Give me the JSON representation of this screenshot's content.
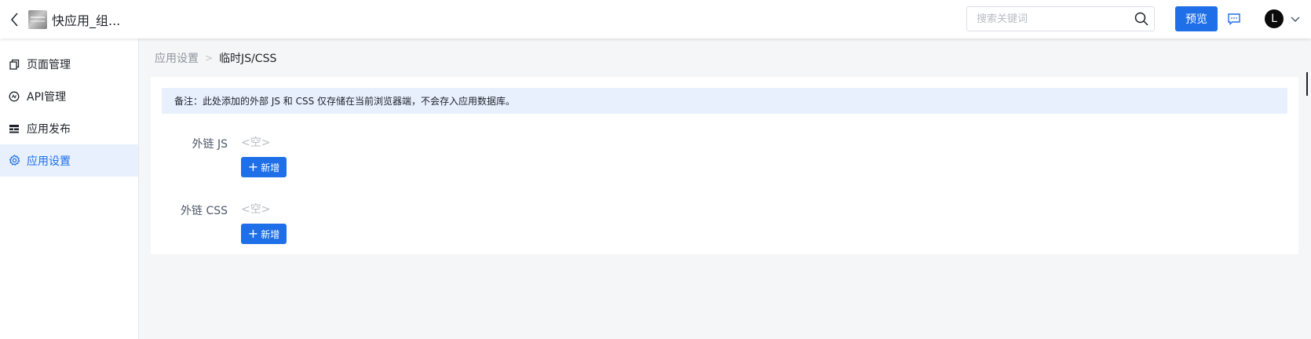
{
  "header": {
    "back_icon": "chevron-left-icon",
    "app_title": "快应用_组...",
    "search_placeholder": "搜索关键词",
    "preview_label": "预览",
    "avatar_initial": "L"
  },
  "sidebar": {
    "items": [
      {
        "label": "页面管理",
        "icon": "page-icon",
        "active": false
      },
      {
        "label": "API管理",
        "icon": "api-icon",
        "active": false
      },
      {
        "label": "应用发布",
        "icon": "publish-icon",
        "active": false
      },
      {
        "label": "应用设置",
        "icon": "gear-icon",
        "active": true
      }
    ]
  },
  "breadcrumb": {
    "parent": "应用设置",
    "separator": ">",
    "current": "临时JS/CSS"
  },
  "main": {
    "notice": "备注：此处添加的外部 JS 和 CSS 仅存储在当前浏览器端，不会存入应用数据库。",
    "js_section": {
      "label": "外链 JS",
      "empty_text": "<空>",
      "add_label": "新增"
    },
    "css_section": {
      "label": "外链 CSS",
      "empty_text": "<空>",
      "add_label": "新增"
    }
  },
  "colors": {
    "primary": "#1e6fe8",
    "notice_bg": "#e8f0fe",
    "page_bg": "#f5f6f7"
  }
}
